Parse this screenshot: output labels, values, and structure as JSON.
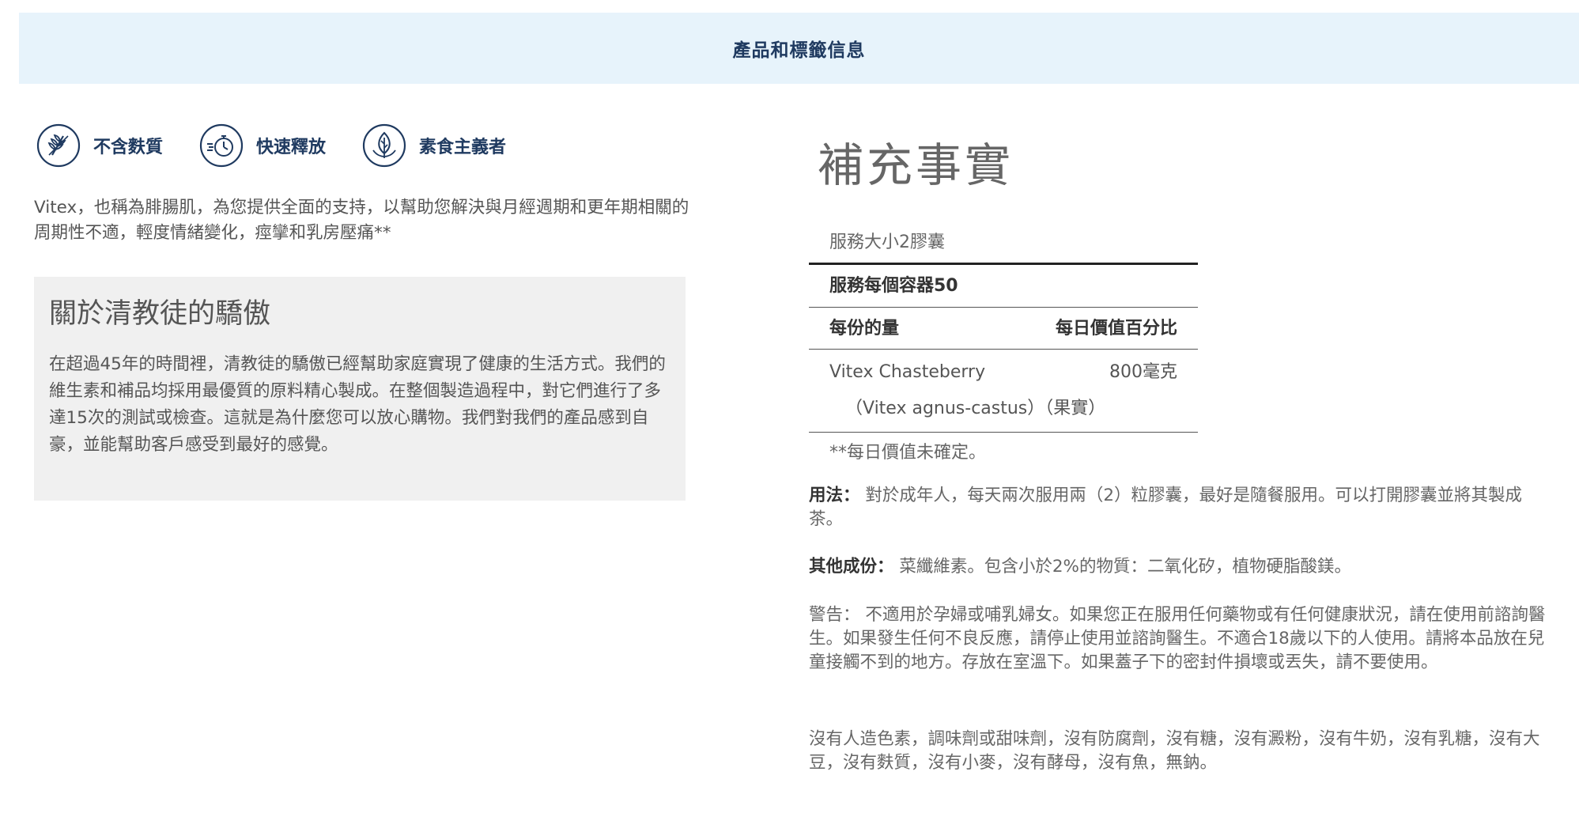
{
  "header": {
    "title": "產品和標籤信息"
  },
  "badges": [
    {
      "label": "不含麩質",
      "icon": "wheat-free-icon"
    },
    {
      "label": "快速釋放",
      "icon": "stopwatch-icon"
    },
    {
      "label": "素食主義者",
      "icon": "leaf-icon"
    }
  ],
  "intro": {
    "text": "Vitex，也稱為腓腸肌，為您提供全面的支持，以幫助您解決與月經週期和更年期相關的周期性不適，輕度情緒變化，痙攣和乳房壓痛**"
  },
  "about": {
    "title": "關於清教徒的驕傲",
    "text": "在超過45年的時間裡，清教徒的驕傲已經幫助家庭實現了健康的生活方式。我們的維生素和補品均採用最優質的原料精心製成。在整個製造過程中，對它們進行了多達15次的測試或檢查。這就是為什麼您可以放心購物。我們對我們的產品感到自豪，並能幫助客戶感受到最好的感覺。"
  },
  "facts": {
    "title": "補充事實",
    "serving_size": "服務大小2膠囊",
    "servings_per_container": "服務每個容器50",
    "col_amount": "每份的量",
    "col_dv": "每日價值百分比",
    "ingredients": [
      {
        "name": "Vitex Chasteberry",
        "amount": "800毫克",
        "sub": "（Vitex agnus-castus）（果實）"
      }
    ],
    "footnote": "**每日價值未確定。"
  },
  "directions": {
    "label": "用法：",
    "text": "對於成年人，每天兩次服用兩（2）粒膠囊，最好是隨餐服用。可以打開膠囊並將其製成茶。"
  },
  "other_ingredients": {
    "label": "其他成份：",
    "text": "菜纖維素。包含小於2%的物質：二氧化矽，植物硬脂酸鎂。"
  },
  "warning": {
    "label": "警告：",
    "text": "不適用於孕婦或哺乳婦女。如果您正在服用任何藥物或有任何健康狀況，請在使用前諮詢醫生。如果發生任何不良反應，請停止使用並諮詢醫生。不適合18歲以下的人使用。請將本品放在兒童接觸不到的地方。存放在室溫下。如果蓋子下的密封件損壞或丟失，請不要使用。"
  },
  "free_from": {
    "text": "沒有人造色素，調味劑或甜味劑，沒有防腐劑，沒有糖，沒有澱粉，沒有牛奶，沒有乳糖，沒有大豆，沒有麩質，沒有小麥，沒有酵母，沒有魚，無鈉。"
  },
  "colors": {
    "accent": "#1f3a60",
    "header_bg": "#e7f3fb",
    "box_bg": "#f0f0f0"
  }
}
